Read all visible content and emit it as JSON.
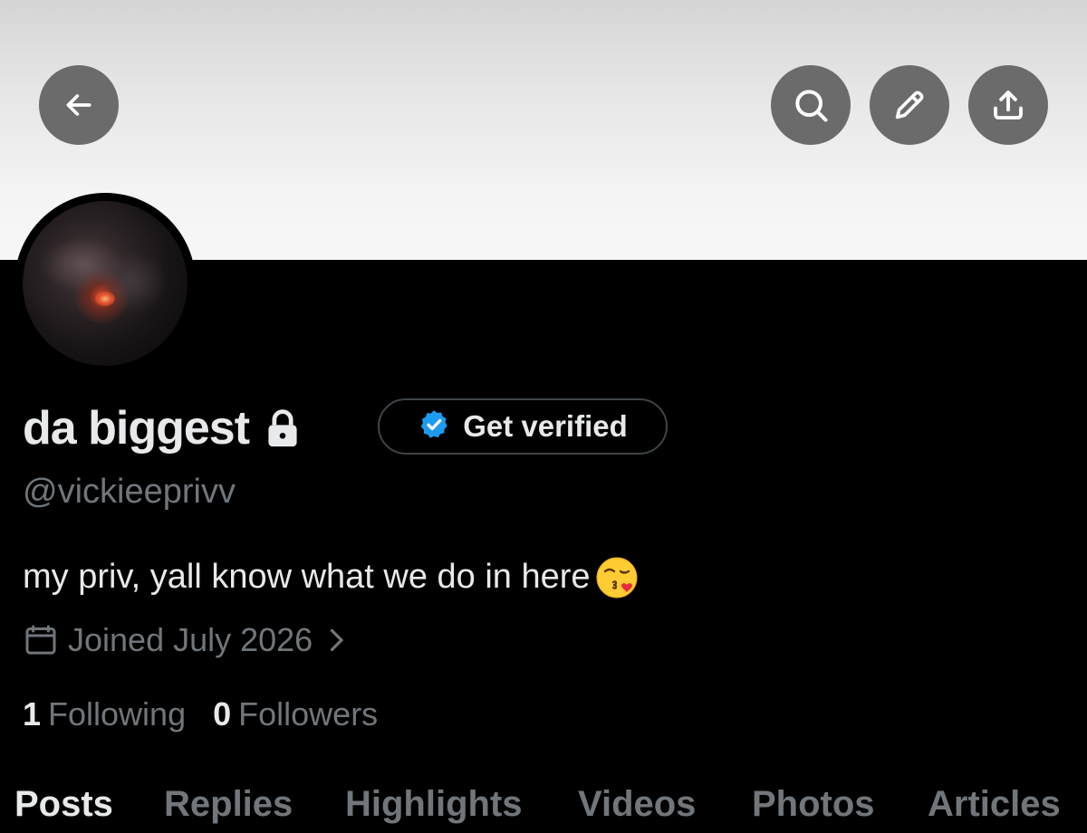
{
  "header": {
    "back_icon": "arrow-left-icon",
    "actions": [
      {
        "name": "search",
        "icon": "search-icon"
      },
      {
        "name": "edit",
        "icon": "pencil-icon"
      },
      {
        "name": "share",
        "icon": "share-icon"
      }
    ],
    "button_color": "#6b6b6b"
  },
  "profile": {
    "display_name": "da biggest",
    "protected_icon": "lock-icon",
    "verify_button": {
      "label": "Get verified",
      "icon": "verified-badge-icon",
      "badge_color": "#1d9bf0"
    },
    "handle": "@vickieeprivv",
    "bio": "my priv, yall know what we do in here",
    "bio_emoji": "😘",
    "joined": {
      "icon": "calendar-icon",
      "text": "Joined July 2026"
    },
    "stats": {
      "following_count": "1",
      "following_label": "Following",
      "followers_count": "0",
      "followers_label": "Followers"
    }
  },
  "tabs": [
    {
      "label": "Posts",
      "active": true
    },
    {
      "label": "Replies",
      "active": false
    },
    {
      "label": "Highlights",
      "active": false
    },
    {
      "label": "Videos",
      "active": false
    },
    {
      "label": "Photos",
      "active": false
    },
    {
      "label": "Articles",
      "active": false
    }
  ],
  "colors": {
    "background": "#000000",
    "primary_text": "#e7e9ea",
    "secondary_text": "#71767b",
    "accent": "#1d9bf0"
  }
}
